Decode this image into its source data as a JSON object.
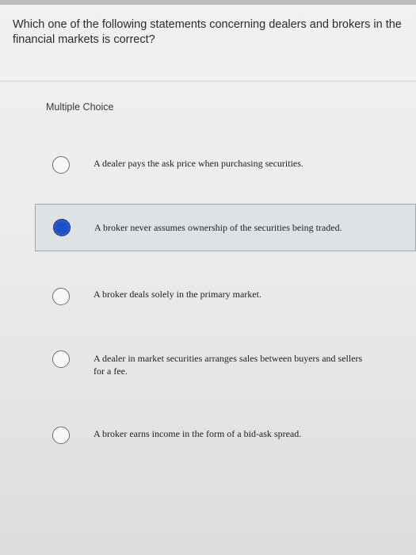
{
  "question": {
    "text": "Which one of the following statements concerning dealers and brokers in the financial markets is correct?"
  },
  "question_type_label": "Multiple Choice",
  "options": [
    {
      "label": "A dealer pays the ask price when purchasing securities.",
      "selected": false
    },
    {
      "label": "A broker never assumes ownership of the securities being traded.",
      "selected": true
    },
    {
      "label": "A broker deals solely in the primary market.",
      "selected": false
    },
    {
      "label": "A dealer in market securities arranges sales between buyers and sellers for a fee.",
      "selected": false
    },
    {
      "label": "A broker earns income in the form of a bid-ask spread.",
      "selected": false
    }
  ],
  "colors": {
    "selected_radio": "#1b52c9",
    "selected_row_bg": "#dfe2e5",
    "selected_row_border": "#9ea6ad"
  }
}
